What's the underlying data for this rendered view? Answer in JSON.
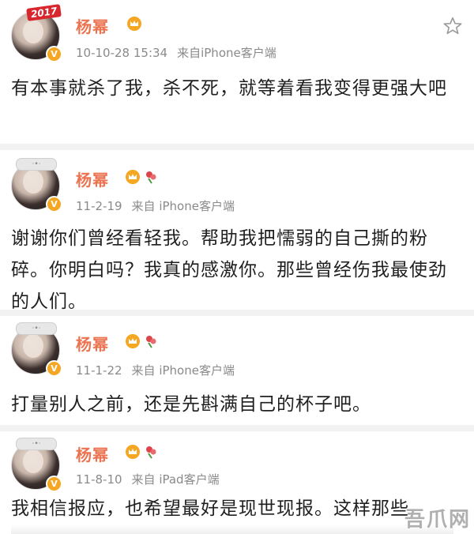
{
  "posts": [
    {
      "username": "杨幂",
      "avatar_badge": "2017",
      "avatar_deco": "",
      "time": "10-10-28 15:34",
      "source": "来自iPhone客户端",
      "content": "有本事就杀了我，杀不死，就等着看我变得更强大吧"
    },
    {
      "username": "杨幂",
      "avatar_badge": "",
      "avatar_deco": "·•·",
      "time": "11-2-19",
      "source": "来自 iPhone客户端",
      "content": "谢谢你们曾经看轻我。帮助我把懦弱的自己撕的粉碎。你明白吗？我真的感激你。那些曾经伤我最使劲的人们。"
    },
    {
      "username": "杨幂",
      "avatar_badge": "",
      "avatar_deco": "·•·",
      "time": "11-1-22",
      "source": "来自 iPhone客户端",
      "content": "打量别人之前，还是先斟满自己的杯子吧。"
    },
    {
      "username": "杨幂",
      "avatar_badge": "",
      "avatar_deco": "·•·",
      "time": "11-8-10",
      "source": "来自 iPad客户端",
      "content": "我相信报应，也希望最好是现世现报。这样那些"
    }
  ],
  "watermark": "吾爪网",
  "icons": {
    "verified": "verified-badge-icon",
    "crown": "crown-icon",
    "flower": "flower-icon",
    "star": "star-icon"
  },
  "colors": {
    "username": "#eb7350",
    "meta": "#8a8a8a",
    "verified": "#f5a623"
  }
}
